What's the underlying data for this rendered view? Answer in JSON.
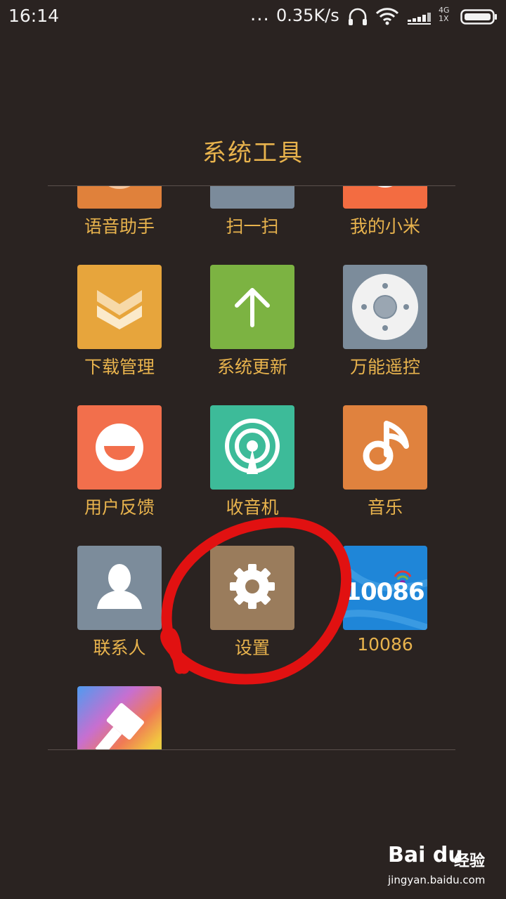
{
  "status_bar": {
    "time": "16:14",
    "more": "...",
    "speed": "0.35K/s",
    "icons": [
      "headphones-icon",
      "wifi-icon",
      "signal-icon",
      "battery-icon"
    ],
    "network_top": "4G",
    "network_bottom": "1X"
  },
  "folder": {
    "title": "系统工具",
    "apps": [
      {
        "label": "语音助手",
        "icon": "voice-assistant-icon",
        "color": "#e0813b"
      },
      {
        "label": "扫一扫",
        "icon": "scanner-icon",
        "color": "#7b8b9b"
      },
      {
        "label": "我的小米",
        "icon": "mi-account-icon",
        "color": "#f36c41"
      },
      {
        "label": "下载管理",
        "icon": "download-icon",
        "color": "#e7a53c"
      },
      {
        "label": "系统更新",
        "icon": "update-arrow-icon",
        "color": "#7cb342"
      },
      {
        "label": "万能遥控",
        "icon": "remote-control-icon",
        "color": "#7c8c9b"
      },
      {
        "label": "用户反馈",
        "icon": "smiley-icon",
        "color": "#f26f4c"
      },
      {
        "label": "收音机",
        "icon": "radio-icon",
        "color": "#3dbb99"
      },
      {
        "label": "音乐",
        "icon": "music-note-icon",
        "color": "#e0823e"
      },
      {
        "label": "联系人",
        "icon": "contact-person-icon",
        "color": "#7c8c9b"
      },
      {
        "label": "设置",
        "icon": "gear-icon",
        "color": "#9a7c5c"
      },
      {
        "label": "10086",
        "icon": "china-mobile-logo",
        "color": "#1f86d8",
        "logo_text": "10086"
      },
      {
        "label": "",
        "icon": "theme-brush-icon",
        "color": "#e9b23d"
      }
    ]
  },
  "annotation": {
    "color": "#e11111",
    "target": "设置"
  },
  "watermark": {
    "logo": "Bai du",
    "experience": "经验",
    "url": "jingyan.baidu.com"
  }
}
